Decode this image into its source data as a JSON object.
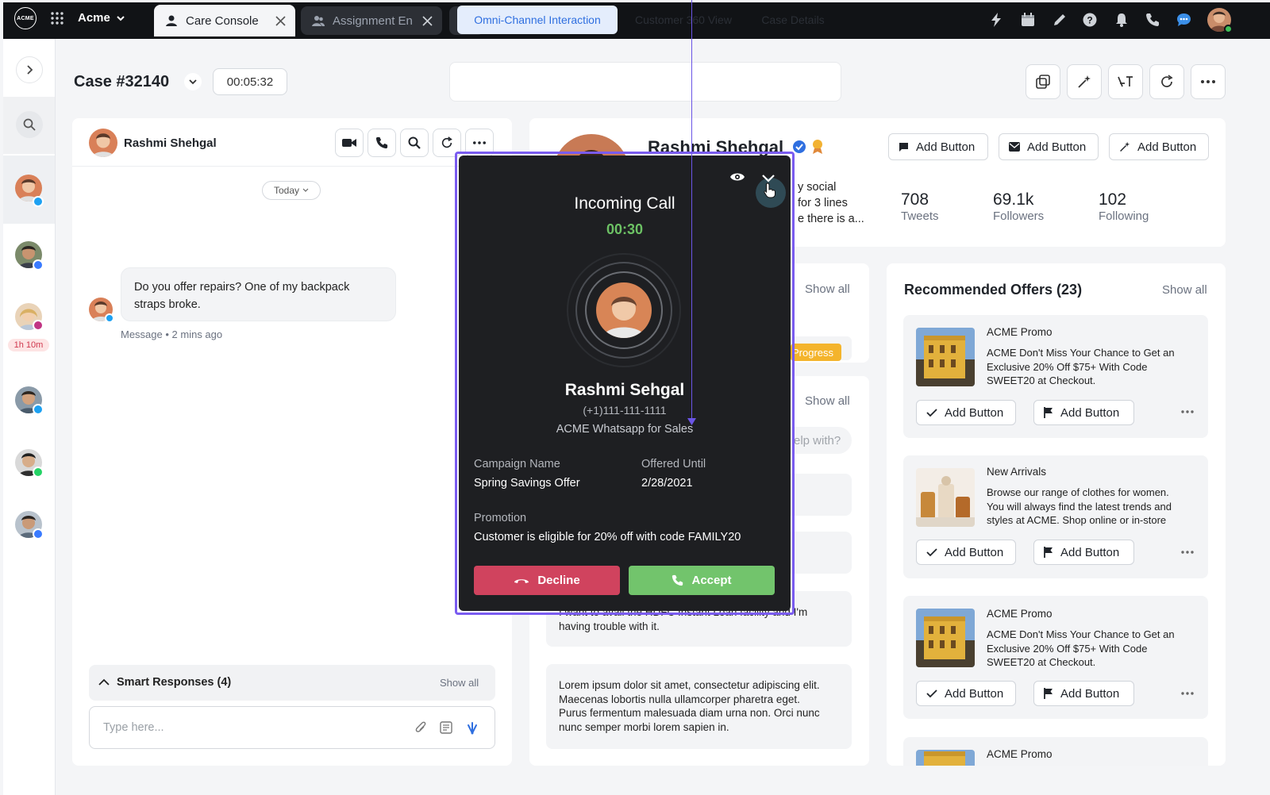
{
  "topbar": {
    "logo_text": "ACME",
    "org_name": "Acme",
    "tabs": [
      {
        "label": "Care Console",
        "active": true
      },
      {
        "label": "Assignment En",
        "active": false
      }
    ]
  },
  "rail": {
    "wait_time": "1h 10m"
  },
  "case": {
    "title": "Case #32140",
    "timer": "00:05:32",
    "views": [
      "Omni-Channel Interaction",
      "Customer 360 View",
      "Case Details"
    ],
    "active_view": "Omni-Channel Interaction"
  },
  "conversation": {
    "customer_name": "Rashmi Shehgal",
    "date_divider": "Today",
    "message": {
      "line1": "Do you offer repairs? One of my backpack",
      "line2": "straps broke.",
      "meta": "Message • 2 mins ago"
    },
    "smart_responses": {
      "label": "Smart Responses (4)",
      "show_all": "Show all"
    },
    "composer_placeholder": "Type here..."
  },
  "profile": {
    "name": "Rashmi Shehgal",
    "bio_lines": [
      "y social",
      "for 3 lines",
      "e there is a..."
    ],
    "stats": [
      {
        "value": "708",
        "label": "Tweets"
      },
      {
        "value": "69.1k",
        "label": "Followers"
      },
      {
        "value": "102",
        "label": "Following"
      }
    ],
    "buttons": [
      "Add Button",
      "Add Button",
      "Add Button"
    ]
  },
  "middle": {
    "show_all_1": "Show all",
    "status_tag": "Progress",
    "show_all_2": "Show all",
    "help_placeholder": "elp with?",
    "card_text_1": [
      "I want to avail the HDFC Instant Loan facility and I'm",
      "having trouble with it."
    ],
    "card_text_2": [
      "Lorem ipsum dolor sit amet, consectetur adipiscing elit.",
      "Maecenas lobortis nulla ullamcorper pharetra eget.",
      "Purus fermentum malesuada diam urna non. Orci nunc",
      "nunc semper morbi lorem sapien in."
    ]
  },
  "offers": {
    "title": "Recommended Offers (23)",
    "show_all": "Show all",
    "items": [
      {
        "title": "ACME Promo",
        "desc": [
          "ACME Don't Miss Your Chance to Get an",
          "Exclusive 20% Off $75+ With Code",
          "SWEET20 at Checkout."
        ],
        "btn1": "Add Button",
        "btn2": "Add Button"
      },
      {
        "title": "New Arrivals",
        "desc": [
          "Browse our range of clothes for women.",
          "You will always find the latest trends and",
          "styles at ACME. Shop online or in-store"
        ],
        "btn1": "Add Button",
        "btn2": "Add Button"
      },
      {
        "title": "ACME Promo",
        "desc": [
          "ACME Don't Miss Your Chance to Get an",
          "Exclusive 20% Off $75+ With Code",
          "SWEET20 at Checkout."
        ],
        "btn1": "Add Button",
        "btn2": "Add Button"
      },
      {
        "title": "ACME Promo"
      }
    ]
  },
  "call": {
    "title": "Incoming Call",
    "timer": "00:30",
    "caller_name": "Rashmi Sehgal",
    "phone": "(+1)111-111-1111",
    "channel": "ACME Whatsapp for Sales",
    "campaign_label": "Campaign Name",
    "campaign_value": "Spring Savings Offer",
    "offered_label": "Offered Until",
    "offered_value": "2/28/2021",
    "promotion_label": "Promotion",
    "promotion_value": "Customer is eligible for 20% off with code FAMILY20",
    "decline": "Decline",
    "accept": "Accept"
  },
  "colors": {
    "accent": "#2f6fe0",
    "call_frame": "#7a5cf0",
    "decline": "#d0435e",
    "accept": "#72c46c",
    "timer_green": "#6cc164",
    "progress": "#f4b42c"
  }
}
